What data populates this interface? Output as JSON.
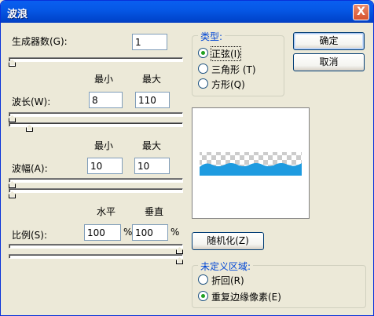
{
  "window": {
    "title": "波浪",
    "close_glyph": "X"
  },
  "generators": {
    "label": "生成器数(G):",
    "value": "1"
  },
  "headers": {
    "min": "最小",
    "max": "最大",
    "horizontal": "水平",
    "vertical": "垂直"
  },
  "wavelength": {
    "label": "波长(W):",
    "min": "8",
    "max": "110"
  },
  "amplitude": {
    "label": "波幅(A):",
    "min": "10",
    "max": "10"
  },
  "scale": {
    "label": "比例(S):",
    "horizontal": "100",
    "vertical": "100",
    "unit": "%"
  },
  "type_group": {
    "title": "类型:",
    "options": [
      {
        "label": "正弦(I)",
        "checked": true
      },
      {
        "label": "三角形 (T)",
        "checked": false
      },
      {
        "label": "方形(Q)",
        "checked": false
      }
    ]
  },
  "buttons": {
    "ok": "确定",
    "cancel": "取消",
    "randomize": "随机化(Z)"
  },
  "undefined_group": {
    "title": "未定义区域:",
    "options": [
      {
        "label": "折回(R)",
        "checked": false
      },
      {
        "label": "重复边缘像素(E)",
        "checked": true
      }
    ]
  },
  "colors": {
    "wave": "#1e9be0",
    "title_bar": "#0a5ff0"
  }
}
